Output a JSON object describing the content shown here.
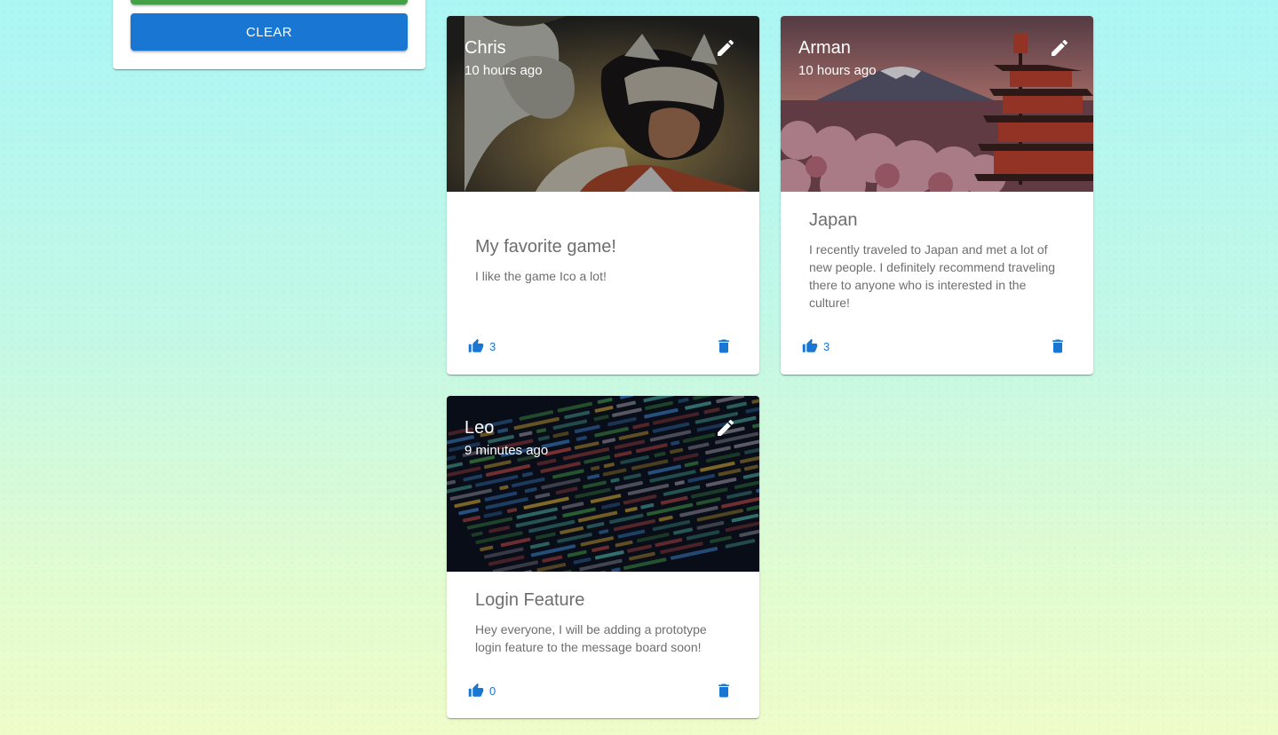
{
  "form": {
    "clear_label": "CLEAR"
  },
  "posts": [
    {
      "author": "Chris",
      "time": "10 hours ago",
      "title": "My favorite game!",
      "body": "I like the game Ico a lot!",
      "likes": "3"
    },
    {
      "author": "Arman",
      "time": "10 hours ago",
      "title": "Japan",
      "body": "I recently traveled to Japan and met a lot of new people. I definitely recommend traveling there to anyone who is interested in the culture!",
      "likes": "3"
    },
    {
      "author": "Leo",
      "time": "9 minutes ago",
      "title": "Login Feature",
      "body": "Hey everyone, I will be adding a prototype login feature to the message board soon!",
      "likes": "0"
    }
  ],
  "icons": {
    "edit": "pencil-icon",
    "like": "thumb-up-icon",
    "delete": "trash-icon"
  },
  "colors": {
    "primary": "#1976d2",
    "submit": "#43a047",
    "text_secondary": "#6e6e6e"
  }
}
